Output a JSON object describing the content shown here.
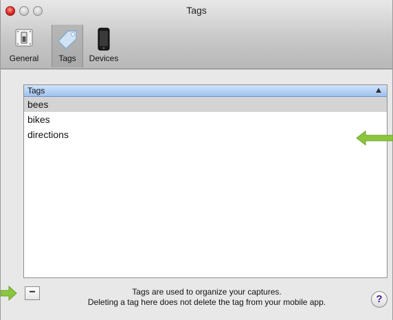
{
  "window": {
    "title": "Tags"
  },
  "toolbar": {
    "items": [
      {
        "label": "General",
        "icon": "switch-icon"
      },
      {
        "label": "Tags",
        "icon": "tag-icon",
        "selected": true
      },
      {
        "label": "Devices",
        "icon": "phone-icon"
      }
    ]
  },
  "table": {
    "header": "Tags",
    "rows": [
      "bees",
      "bikes",
      "directions"
    ],
    "selected_row": "bees"
  },
  "footer": {
    "remove_label": "−",
    "info_line1": "Tags are used to organize your captures.",
    "info_line2": "Deleting a tag here does not delete the tag from your mobile app.",
    "help_label": "?"
  },
  "colors": {
    "annotation_arrow": "#8cc63f",
    "header_blue": "#9fc2ef"
  }
}
